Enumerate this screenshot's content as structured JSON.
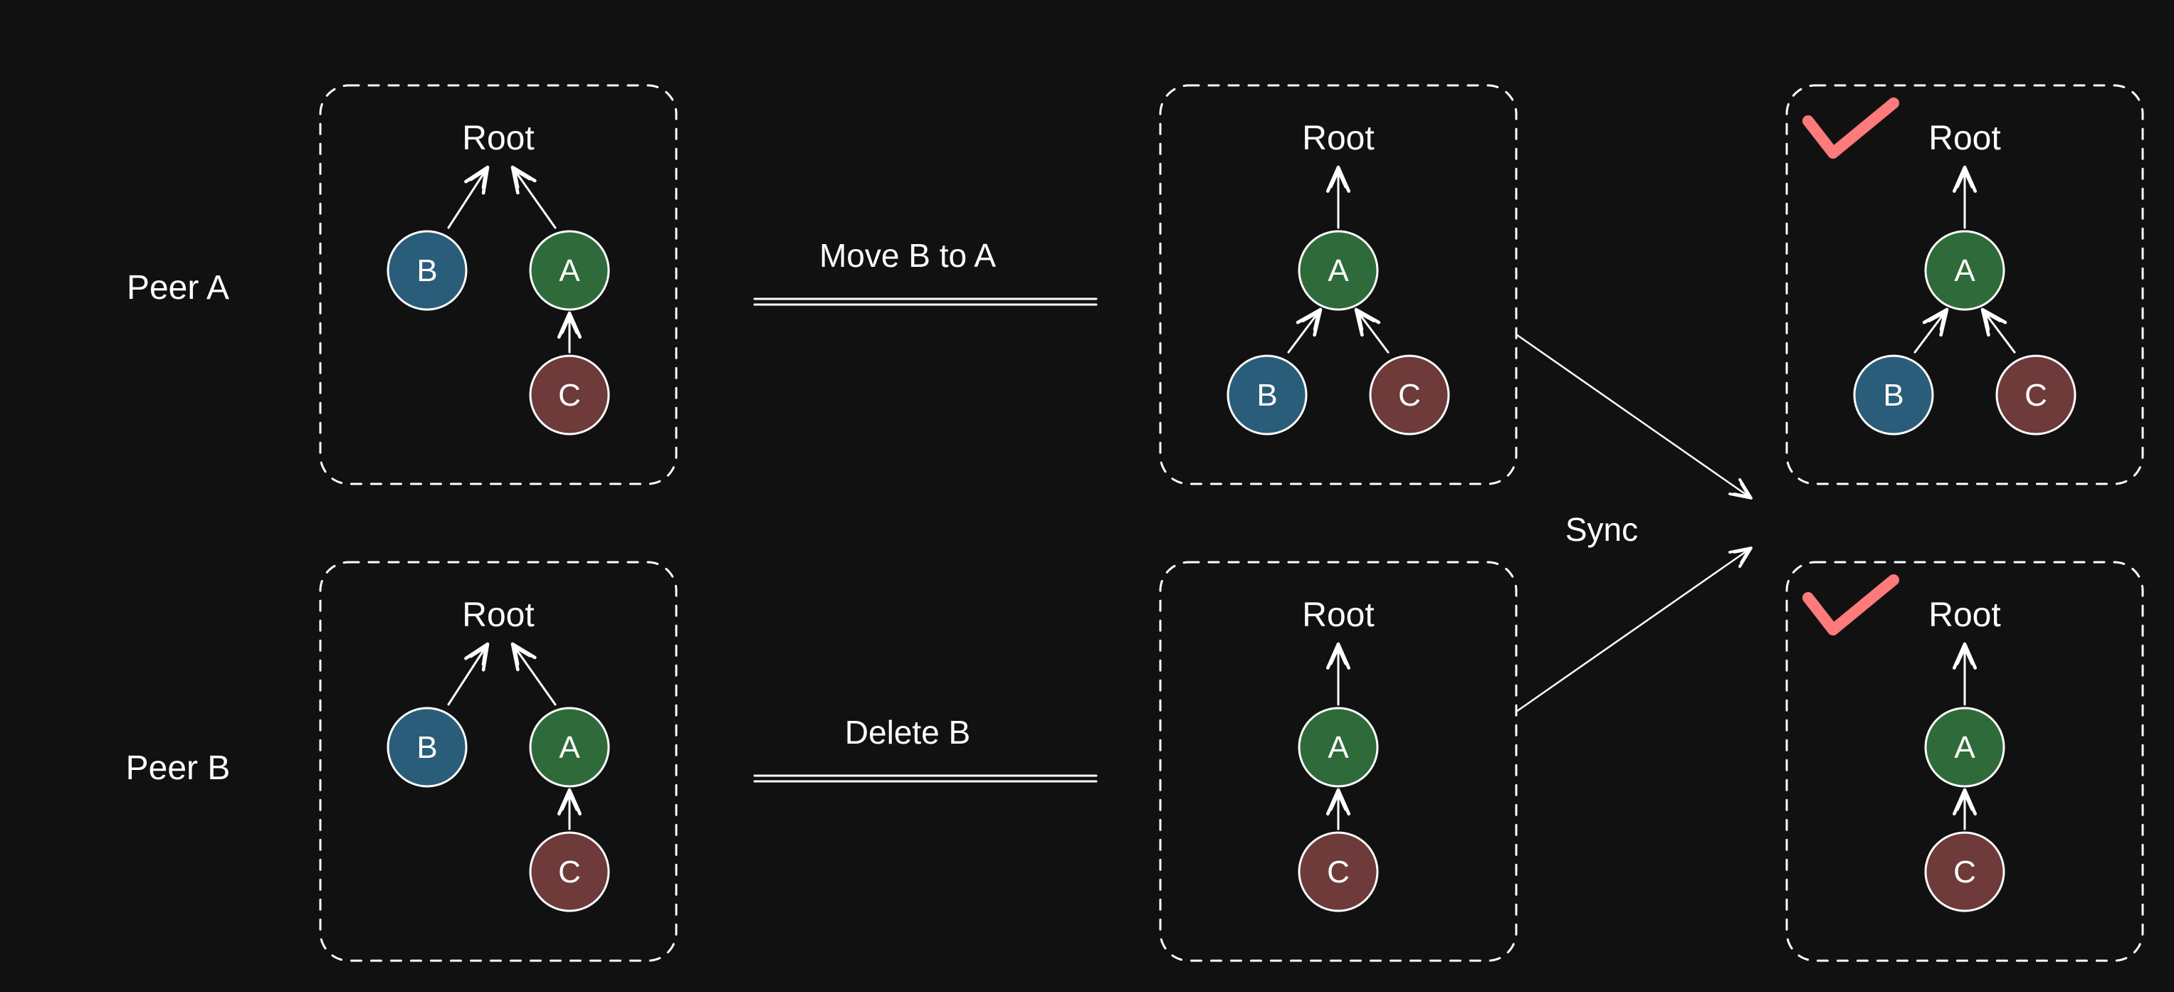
{
  "labels": {
    "peerA": "Peer A",
    "peerB": "Peer B",
    "root": "Root",
    "A": "A",
    "B": "B",
    "C": "C",
    "moveBtoA": "Move B to A",
    "deleteB": "Delete B",
    "sync": "Sync"
  },
  "colors": {
    "bg": "#111111",
    "stroke": "#ffffff",
    "nodeA": "#2f6b3a",
    "nodeB": "#2a5d7a",
    "nodeC": "#6e3a3a",
    "check": "#ff7a7a"
  },
  "diagram": {
    "description": "CRDT / distributed tree sync example. Two peers start with the same tree (Root→{B,A}, A→C). Peer A moves B under A. Peer B deletes B. After sync, Peer A ends with Root→A→{B,C} and Peer B ends with Root→A→C; both states are marked as valid (checkmark).",
    "initialTree": {
      "Root": [
        "B",
        "A"
      ],
      "A": [
        "C"
      ]
    },
    "peerA_op": "move B under A",
    "peerB_op": "delete B",
    "peerA_afterOp": {
      "Root": [
        "A"
      ],
      "A": [
        "B",
        "C"
      ]
    },
    "peerB_afterOp": {
      "Root": [
        "A"
      ],
      "A": [
        "C"
      ]
    },
    "peerA_afterSync": {
      "Root": [
        "A"
      ],
      "A": [
        "B",
        "C"
      ]
    },
    "peerB_afterSync": {
      "Root": [
        "A"
      ],
      "A": [
        "C"
      ]
    },
    "syncResultsValid": {
      "peerA": true,
      "peerB": true
    }
  }
}
